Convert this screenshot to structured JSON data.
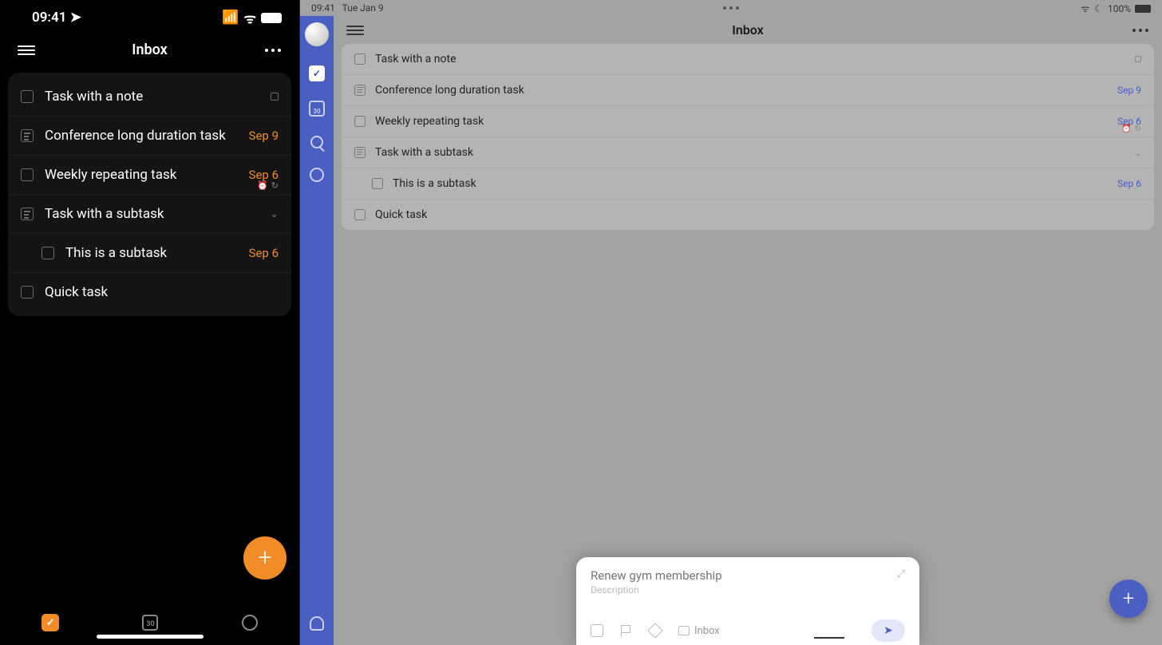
{
  "phone": {
    "time": "09:41",
    "title": "Inbox",
    "tasks": [
      {
        "title": "Task with a note",
        "kind": "check",
        "note": true
      },
      {
        "title": "Conference long duration task",
        "kind": "desc",
        "date": "Sep 9"
      },
      {
        "title": "Weekly repeating task",
        "kind": "check",
        "date": "Sep 6",
        "meta": true
      },
      {
        "title": "Task with a subtask",
        "kind": "desc",
        "tree": true
      },
      {
        "title": "This is a subtask",
        "kind": "check",
        "date": "Sep 6",
        "sub": true
      },
      {
        "title": "Quick task",
        "kind": "check"
      }
    ],
    "cal_day": "30"
  },
  "tablet": {
    "time": "09:41",
    "date_top": "Tue Jan 9",
    "battery": "100%",
    "title": "Inbox",
    "cal_day": "30",
    "tasks": [
      {
        "title": "Task with a note",
        "kind": "check",
        "note": true
      },
      {
        "title": "Conference long duration task",
        "kind": "desc",
        "date": "Sep 9"
      },
      {
        "title": "Weekly repeating task",
        "kind": "check",
        "date": "Sep 6",
        "meta": true
      },
      {
        "title": "Task with a subtask",
        "kind": "desc",
        "tree": true
      },
      {
        "title": "This is a subtask",
        "kind": "check",
        "date": "Sep 6",
        "sub": true
      },
      {
        "title": "Quick task",
        "kind": "check"
      }
    ],
    "sheet": {
      "placeholder": "Renew gym membership",
      "desc": "Description",
      "list": "Inbox"
    }
  }
}
